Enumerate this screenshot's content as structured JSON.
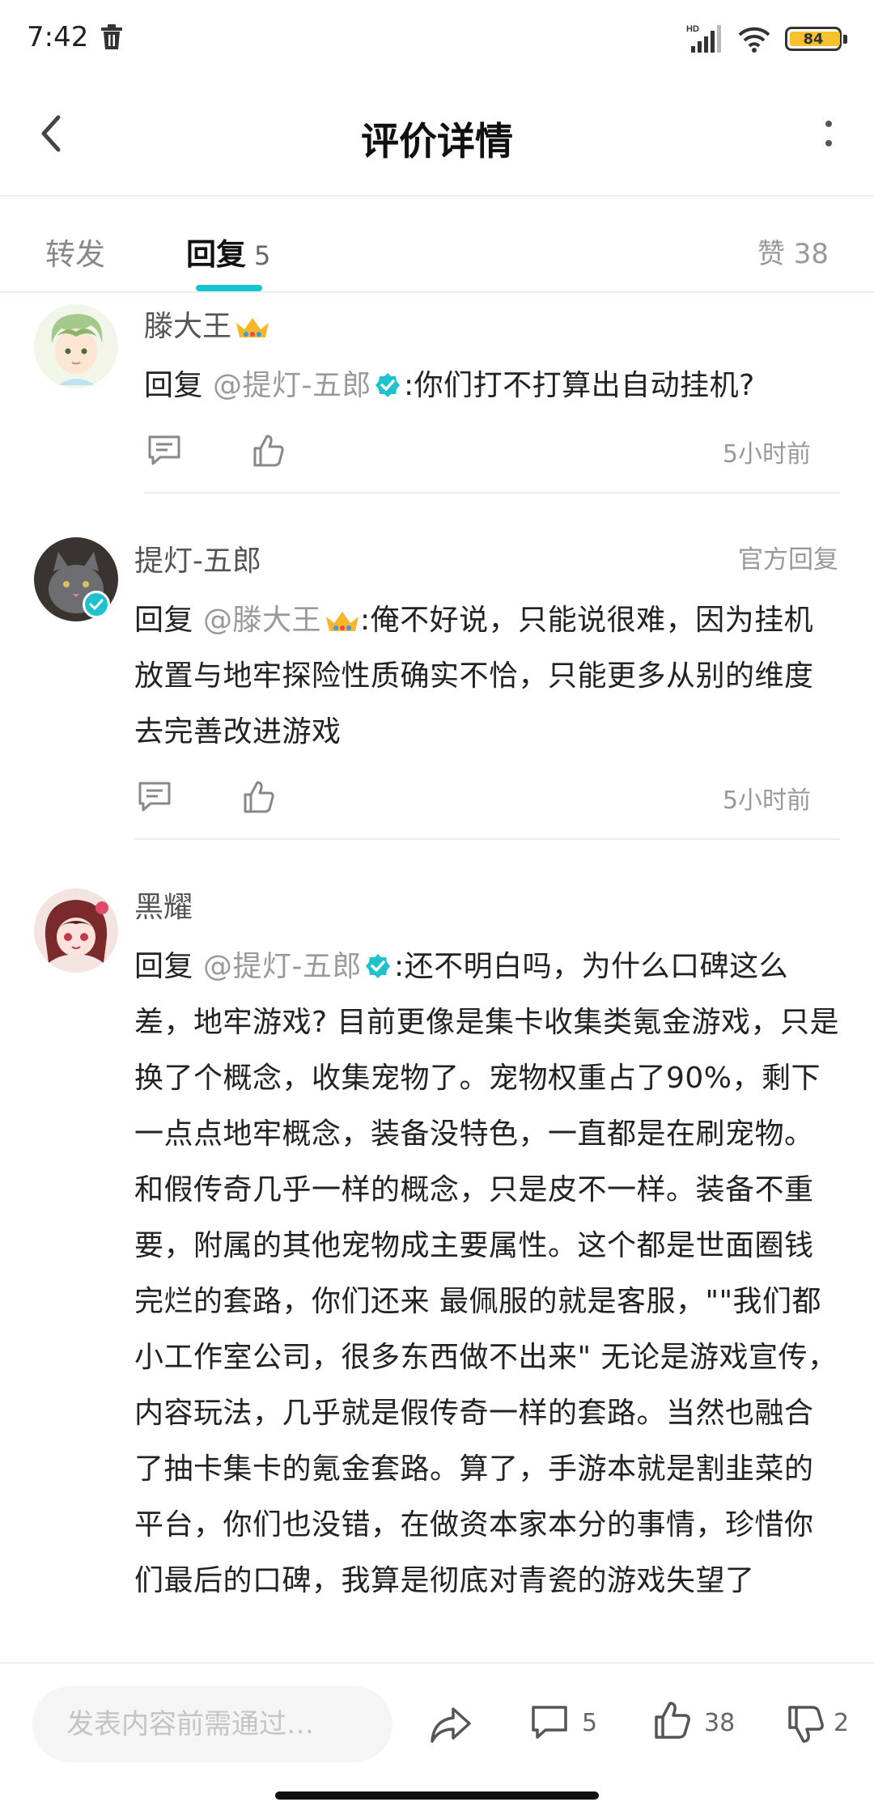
{
  "status_bar": {
    "time": "7:42",
    "battery": "84",
    "network": "HD"
  },
  "header": {
    "title": "评价详情",
    "back_icon": "chevron-left-icon",
    "more_icon": "more-vertical-icon"
  },
  "tabs": {
    "repost_label": "转发",
    "reply_label": "回复",
    "reply_count": "5",
    "likes_label": "赞 38"
  },
  "comments": [
    {
      "username": "滕大王",
      "reply_prefix": "回复",
      "mention": "@提灯-五郎",
      "text": ":你们打不打算出自动挂机?",
      "time": "5小时前"
    },
    {
      "username": "提灯-五郎",
      "official_tag": "官方回复",
      "reply_prefix": "回复",
      "mention": "@滕大王",
      "text": ":俺不好说，只能说很难，因为挂机放置与地牢探险性质确实不恰，只能更多从别的维度去完善改进游戏",
      "time": "5小时前"
    },
    {
      "username": "黑耀",
      "reply_prefix": "回复",
      "mention": "@提灯-五郎",
      "text": ":还不明白吗，为什么口碑这么差，地牢游戏? 目前更像是集卡收集类氪金游戏，只是换了个概念，收集宠物了。宠物权重占了90%，剩下一点点地牢概念，装备没特色，一直都是在刷宠物。和假传奇几乎一样的概念，只是皮不一样。装备不重要，附属的其他宠物成主要属性。这个都是世面圈钱完烂的套路，你们还来 最佩服的就是客服，\"\"我们都小工作室公司，很多东西做不出来\" 无论是游戏宣传，内容玩法，几乎就是假传奇一样的套路。当然也融合了抽卡集卡的氪金套路。算了，手游本就是割韭菜的平台，你们也没错，在做资本家本分的事情，珍惜你们最后的口碑，我算是彻底对青瓷的游戏失望了"
    }
  ],
  "bottom_bar": {
    "input_placeholder": "发表内容前需通过…",
    "comment_count": "5",
    "like_count": "38",
    "dislike_count": "2"
  },
  "colors": {
    "accent": "#15c5ce",
    "verified": "#1ec2cf",
    "battery": "#f6c12c",
    "mention": "#9a9a9a"
  }
}
